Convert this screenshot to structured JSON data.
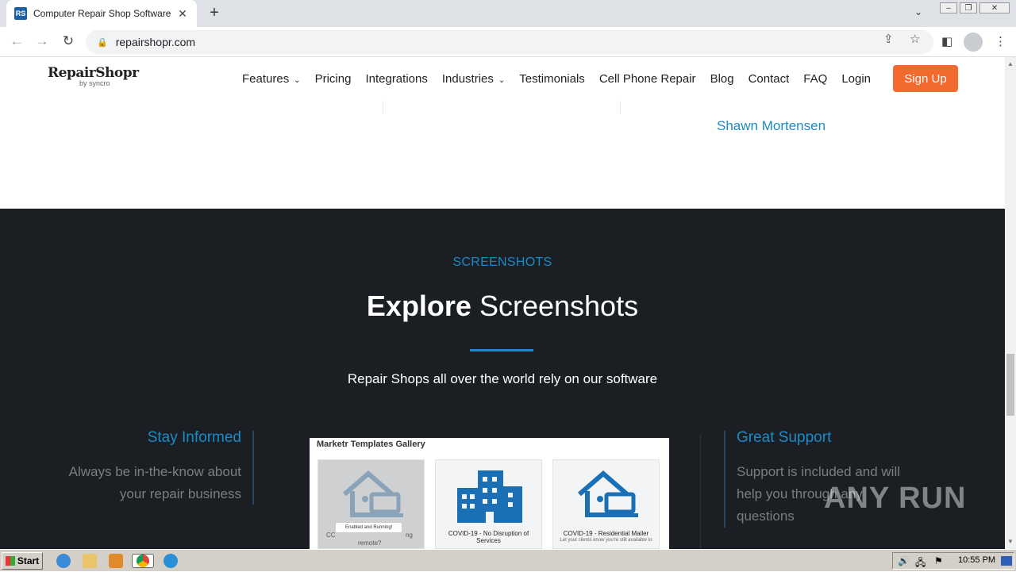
{
  "browser": {
    "tab_title": "Computer Repair Shop Software – C",
    "favicon_text": "RS",
    "url": "repairshopr.com"
  },
  "site": {
    "logo_main": "RepairShopr",
    "logo_sub": "by syncro",
    "nav": [
      {
        "label": "Features",
        "has_caret": true
      },
      {
        "label": "Pricing"
      },
      {
        "label": "Integrations"
      },
      {
        "label": "Industries",
        "has_caret": true
      },
      {
        "label": "Testimonials"
      },
      {
        "label": "Cell Phone Repair"
      },
      {
        "label": "Blog"
      },
      {
        "label": "Contact"
      },
      {
        "label": "FAQ"
      },
      {
        "label": "Login"
      }
    ],
    "signup_label": "Sign Up",
    "accent_color": "#f26a2e",
    "link_color": "#1b8bc7"
  },
  "testimonial": {
    "author": "Shawn Mortensen"
  },
  "screenshots": {
    "eyebrow": "SCREENSHOTS",
    "headline_bold": "Explore",
    "headline_light": "Screenshots",
    "subline": "Repair Shops all over the world rely on our software",
    "left_feature": {
      "title": "Stay Informed",
      "desc_line1": "Always be in-the-know about",
      "desc_line2": "your repair business"
    },
    "right_feature": {
      "title": "Great Support",
      "desc_line1": "Support is included and will",
      "desc_line2": "help you through any",
      "desc_line3": "questions"
    },
    "gallery": {
      "title": "Marketr Templates Gallery",
      "cards": [
        {
          "label": "",
          "badge": "Enabled and Running!",
          "cut1": "CC",
          "cut2": "remote?",
          "cut_right": "ng"
        },
        {
          "label": "COVID-19 - No Disruption of Services",
          "sub": ""
        },
        {
          "label": "COVID-19 - Residential Mailer",
          "sub": "Let your clients know you're still available to"
        }
      ]
    }
  },
  "watermark": "ANY RUN",
  "taskbar": {
    "start_label": "Start",
    "clock": "10:55 PM"
  }
}
